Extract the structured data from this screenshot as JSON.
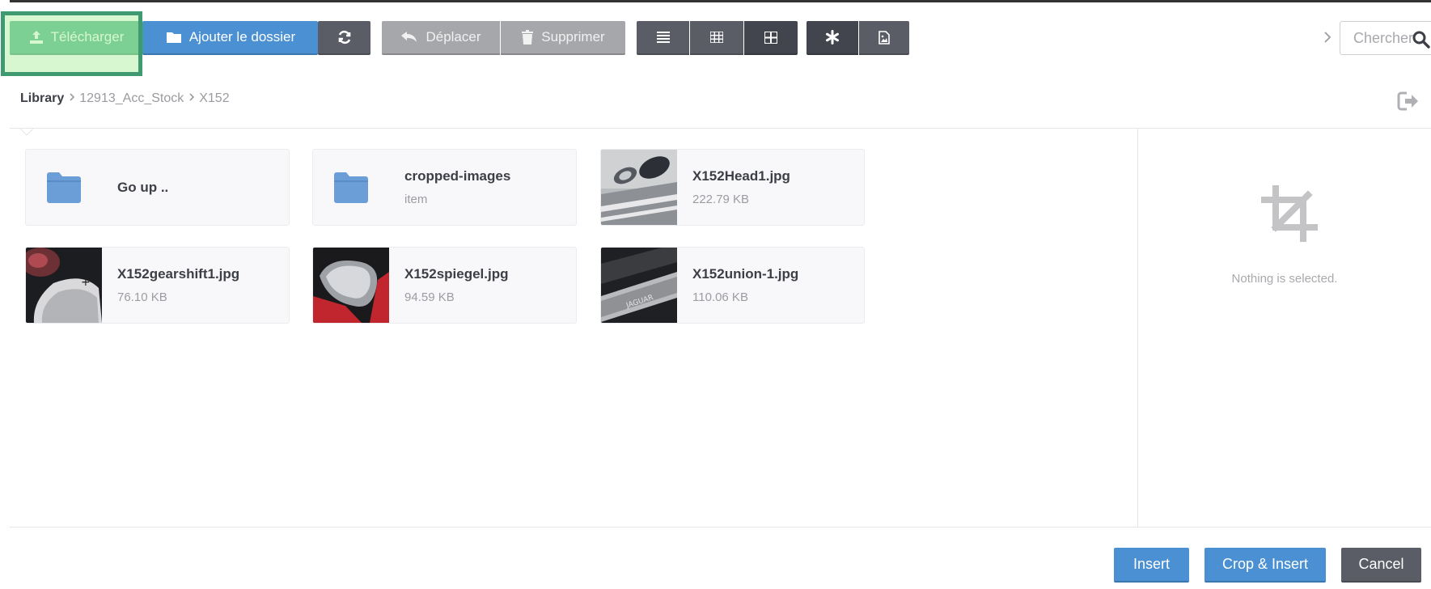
{
  "toolbar": {
    "upload_label": "Télécharger",
    "add_folder_label": "Ajouter le dossier",
    "refresh_icon": "refresh-icon",
    "move_label": "Déplacer",
    "delete_label": "Supprimer",
    "view_list_icon": "list-view-icon",
    "view_small_grid_icon": "small-grid-view-icon",
    "view_large_grid_icon": "large-grid-view-icon",
    "filter_all_icon": "asterisk-icon",
    "filter_images_icon": "image-file-icon"
  },
  "search": {
    "placeholder": "Chercher"
  },
  "breadcrumb": {
    "root": "Library",
    "items": [
      "12913_Acc_Stock",
      "X152"
    ]
  },
  "files": [
    {
      "name": "Go up ..",
      "sub": "",
      "kind": "folder"
    },
    {
      "name": "cropped-images",
      "sub": "item",
      "kind": "folder"
    },
    {
      "name": "X152Head1.jpg",
      "sub": "222.79 KB",
      "kind": "image"
    },
    {
      "name": "X152gearshift1.jpg",
      "sub": "76.10 KB",
      "kind": "image"
    },
    {
      "name": "X152spiegel.jpg",
      "sub": "94.59 KB",
      "kind": "image"
    },
    {
      "name": "X152union-1.jpg",
      "sub": "110.06 KB",
      "kind": "image"
    }
  ],
  "preview": {
    "empty_text": "Nothing is selected."
  },
  "footer": {
    "insert_label": "Insert",
    "crop_insert_label": "Crop & Insert",
    "cancel_label": "Cancel"
  },
  "colors": {
    "upload": "#3aa879",
    "primary": "#4a90d3",
    "dark": "#5a5d66",
    "disabled": "#a6a7ab",
    "highlight_border": "#3f9a72"
  }
}
